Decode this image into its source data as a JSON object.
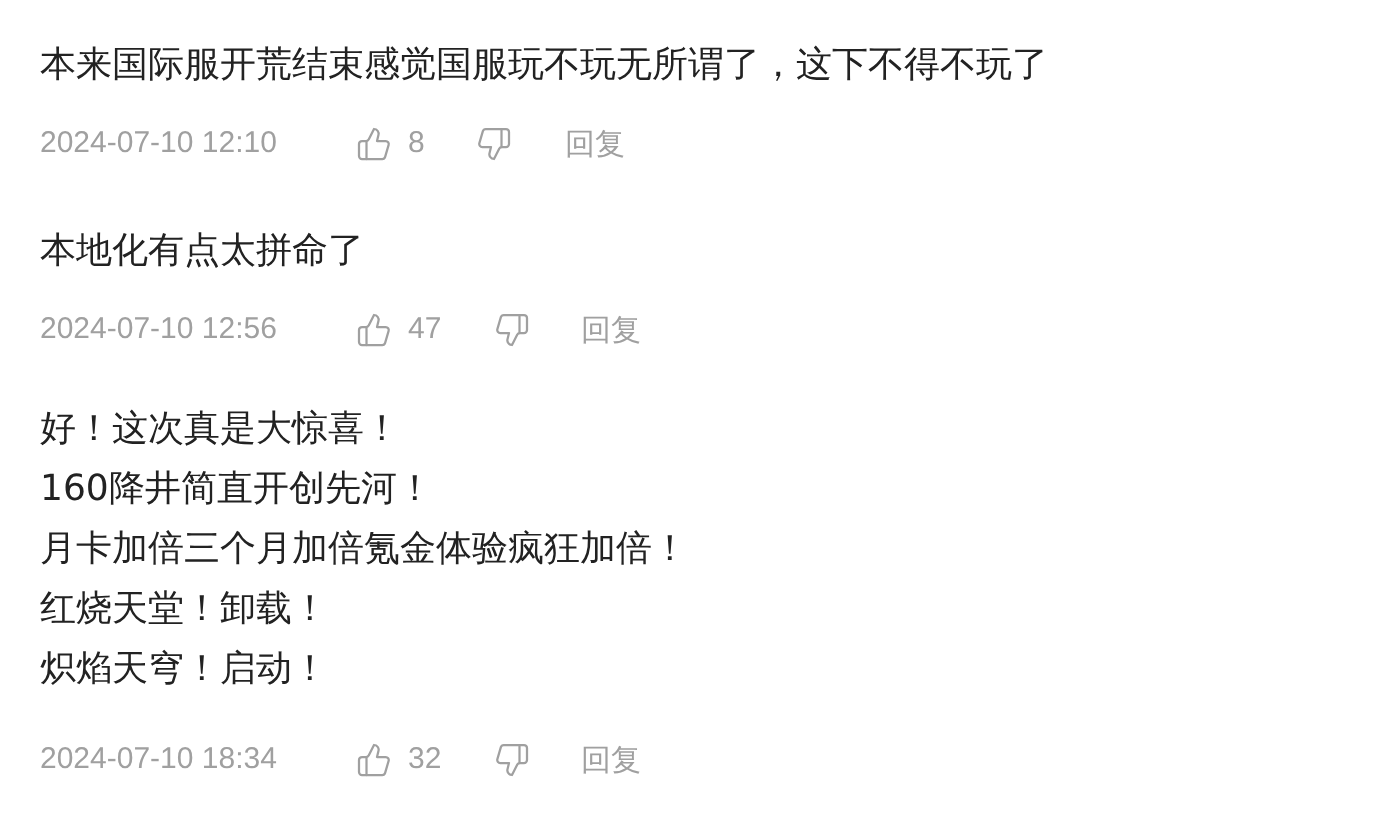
{
  "comments": [
    {
      "lines": [
        "本来国际服开荒结束感觉国服玩不玩无所谓了，这下不得不玩了"
      ],
      "time": "2024-07-10 12:10",
      "likes": "8",
      "reply": "回复"
    },
    {
      "lines": [
        "本地化有点太拼命了"
      ],
      "time": "2024-07-10 12:56",
      "likes": "47",
      "reply": "回复"
    },
    {
      "lines": [
        "好！这次真是大惊喜！",
        "160降井简直开创先河！",
        "月卡加倍三个月加倍氪金体验疯狂加倍！",
        "红烧天堂！卸载！",
        "炽焰天穹！启动！"
      ],
      "time": "2024-07-10 18:34",
      "likes": "32",
      "reply": "回复"
    }
  ]
}
